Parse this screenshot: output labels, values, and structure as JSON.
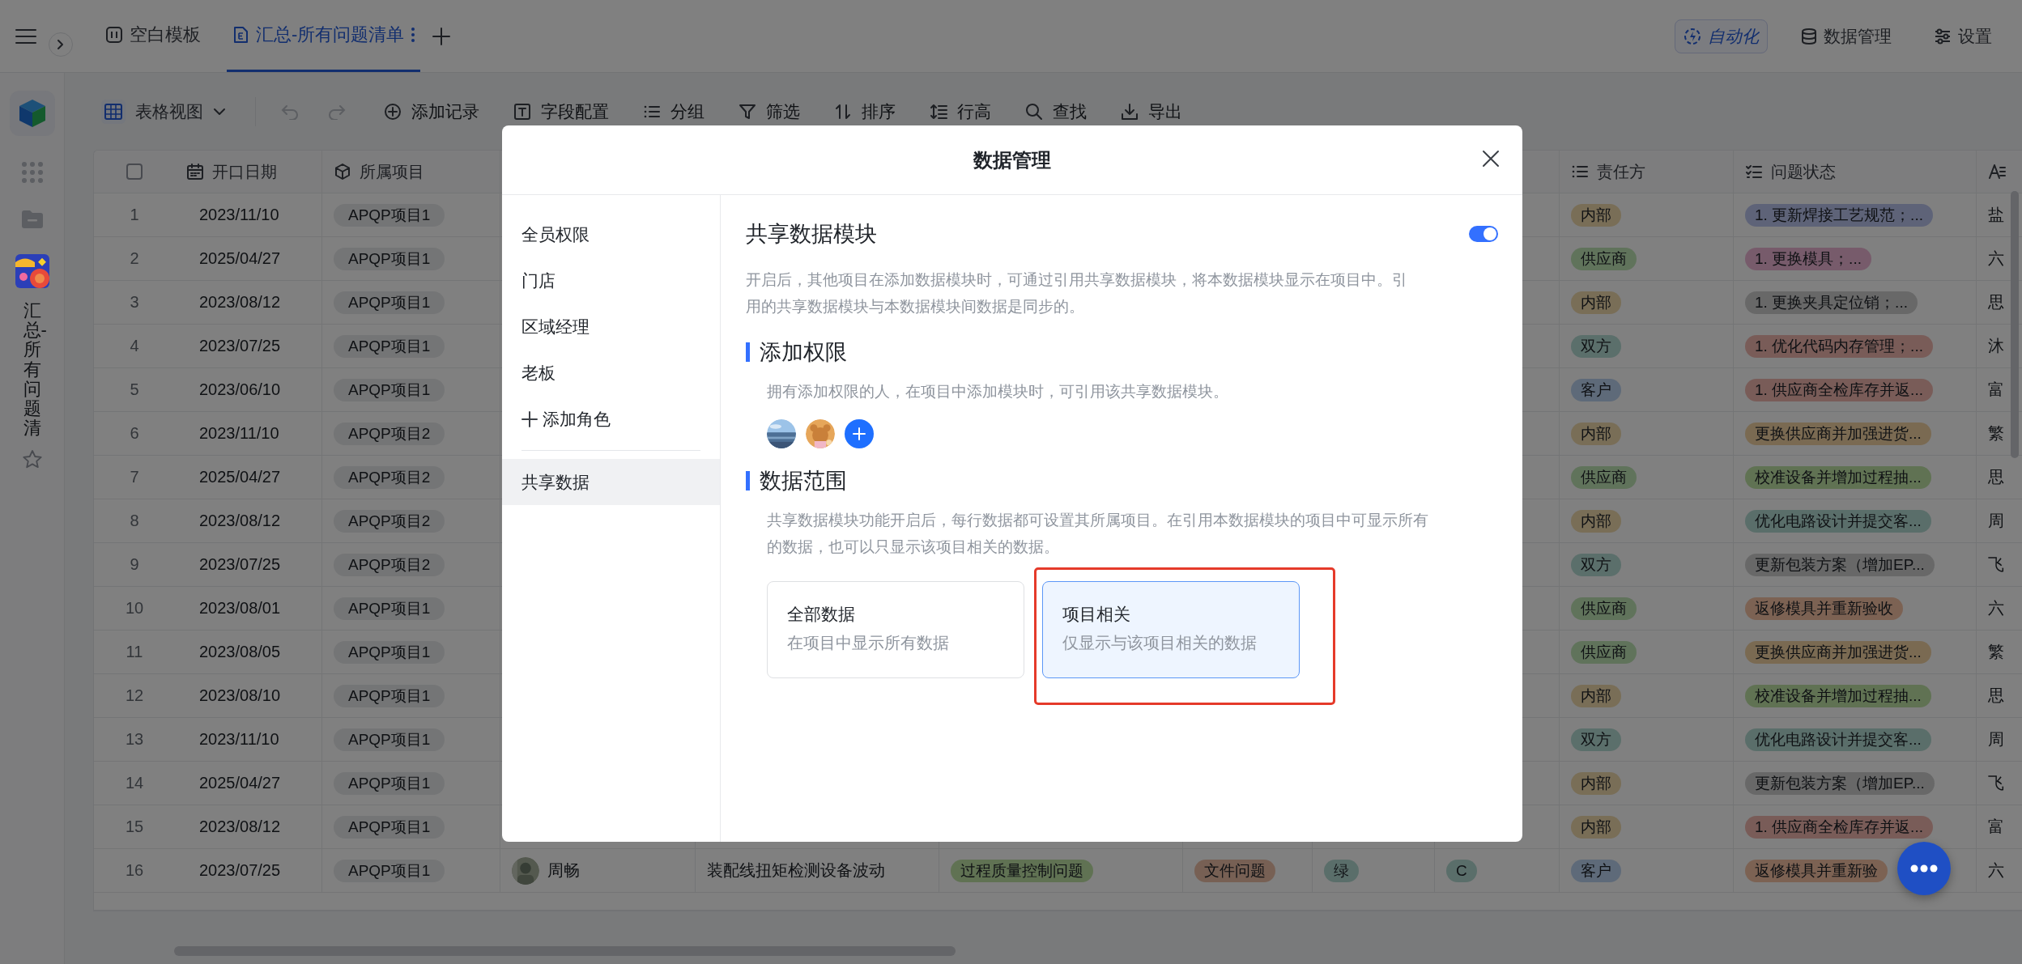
{
  "tabs": [
    {
      "label": "空白模板",
      "selected": false
    },
    {
      "label": "汇总-所有问题清单",
      "selected": true
    }
  ],
  "header_actions": [
    {
      "label": "自动化",
      "highlighted": true
    },
    {
      "label": "数据管理",
      "highlighted": false
    },
    {
      "label": "设置",
      "highlighted": false
    }
  ],
  "rail": {
    "module_title": "汇总-所有问题清"
  },
  "toolbar": {
    "view": "表格视图",
    "actions": [
      "添加记录",
      "字段配置",
      "分组",
      "筛选",
      "排序",
      "行高",
      "查找",
      "导出"
    ]
  },
  "table": {
    "select_all": {
      "checked": false
    },
    "columns": [
      "开口日期",
      "所属项目",
      "责任方",
      "问题状态"
    ],
    "rows": [
      {
        "number": "1",
        "date": "2023/11/10",
        "project": "APQP项目1",
        "owner": {
          "text": "内部",
          "color": "#796e57"
        },
        "status": {
          "text": "1. 更新焊接工艺规范；...",
          "color": "#5e6378"
        },
        "column_12": "盐"
      },
      {
        "number": "2",
        "date": "2025/04/27",
        "project": "APQP项目1",
        "owner": {
          "text": "供应商",
          "color": "#60735b"
        },
        "status": {
          "text": "1. 更换模具；...",
          "color": "#775b6b"
        },
        "column_12": "六"
      },
      {
        "number": "3",
        "date": "2023/08/12",
        "project": "APQP项目1",
        "owner": {
          "text": "内部",
          "color": "#796e57"
        },
        "status": {
          "text": "1. 更换夹具定位销；...",
          "color": "#686868"
        },
        "column_12": "思"
      },
      {
        "number": "4",
        "date": "2023/07/25",
        "project": "APQP项目1",
        "owner": {
          "text": "双方",
          "color": "#5b6f6b"
        },
        "status": {
          "text": "1. 优化代码内存管理；...",
          "color": "#795c58"
        },
        "column_12": "沐"
      },
      {
        "number": "5",
        "date": "2023/06/10",
        "project": "APQP项目1",
        "owner": {
          "text": "客户",
          "color": "#5e6a79"
        },
        "status": {
          "text": "1. 供应商全检库存并返...",
          "color": "#795c58"
        },
        "column_12": "富"
      },
      {
        "number": "6",
        "date": "2023/11/10",
        "project": "APQP项目2",
        "owner": {
          "text": "内部",
          "color": "#796e57"
        },
        "status": {
          "text": "更换供应商并加强进货...",
          "color": "#7a6a52"
        },
        "column_12": "繁"
      },
      {
        "number": "7",
        "date": "2025/04/27",
        "project": "APQP项目2",
        "owner": {
          "text": "供应商",
          "color": "#60735b"
        },
        "status": {
          "text": "校准设备并增加过程抽...",
          "color": "#607253"
        },
        "column_12": "思"
      },
      {
        "number": "8",
        "date": "2023/08/12",
        "project": "APQP项目2",
        "owner": {
          "text": "内部",
          "color": "#796e57"
        },
        "status": {
          "text": "优化电路设计并提交客...",
          "color": "#5a6e6a"
        },
        "column_12": "周"
      },
      {
        "number": "9",
        "date": "2023/07/25",
        "project": "APQP项目2",
        "owner": {
          "text": "双方",
          "color": "#5b6f6b"
        },
        "status": {
          "text": "更新包装方案（增加EP...",
          "color": "#686868"
        },
        "column_12": "飞"
      },
      {
        "number": "10",
        "date": "2023/08/01",
        "project": "APQP项目1",
        "owner": {
          "text": "供应商",
          "color": "#60735b"
        },
        "status": {
          "text": "返修模具并重新验收",
          "color": "#7c6253"
        },
        "column_12": "六"
      },
      {
        "number": "11",
        "date": "2023/08/05",
        "project": "APQP项目1",
        "owner": {
          "text": "供应商",
          "color": "#60735b"
        },
        "status": {
          "text": "更换供应商并加强进货...",
          "color": "#7a6a52"
        },
        "column_12": "繁"
      },
      {
        "number": "12",
        "date": "2023/08/10",
        "project": "APQP项目1",
        "owner": {
          "text": "内部",
          "color": "#796e57"
        },
        "status": {
          "text": "校准设备并增加过程抽...",
          "color": "#607253"
        },
        "column_12": "思"
      },
      {
        "number": "13",
        "date": "2023/11/10",
        "project": "APQP项目1",
        "owner": {
          "text": "双方",
          "color": "#5b6f6b"
        },
        "status": {
          "text": "优化电路设计并提交客...",
          "color": "#5a6e6a"
        },
        "column_12": "周"
      },
      {
        "number": "14",
        "date": "2025/04/27",
        "project": "APQP项目1",
        "owner": {
          "text": "内部",
          "color": "#796e57"
        },
        "status": {
          "text": "更新包装方案（增加EP...",
          "color": "#686868"
        },
        "column_12": "飞"
      },
      {
        "number": "15",
        "date": "2023/08/12",
        "project": "APQP项目1",
        "owner": {
          "text": "内部",
          "color": "#796e57"
        },
        "status": {
          "text": "1. 供应商全检库存并返...",
          "color": "#795c58"
        },
        "column_12": "富"
      },
      {
        "number": "16",
        "date": "2023/07/25",
        "project": "APQP项目1",
        "column_4": {
          "text": "周畅",
          "kind": "picture"
        },
        "column_5": "装配线扭矩检测设备波动",
        "column_6": {
          "text": "过程质量控制问题",
          "color": "#607253"
        },
        "column_7": {
          "text": "文件问题",
          "color": "#776054"
        },
        "column_8": {
          "text": "绿",
          "color": "#5a6e6a"
        },
        "column_9": {
          "text": "C",
          "color": "#5a6e6a"
        },
        "owner": {
          "text": "客户",
          "color": "#5e6a79"
        },
        "status": {
          "text": "返修模具并重新验",
          "color": "#7c6253"
        },
        "column_12": "六"
      }
    ]
  },
  "dialog": {
    "title": "数据管理",
    "menu": {
      "roles": [
        {
          "label": "全员权限",
          "selected": false
        },
        {
          "label": "门店",
          "selected": false
        },
        {
          "label": "区域经理",
          "selected": false
        },
        {
          "label": "老板",
          "selected": false
        }
      ],
      "add_label": "添加角色",
      "shared": [
        {
          "label": "共享数据",
          "selected": true
        }
      ]
    },
    "content": {
      "title": "共享数据模块",
      "toggle_on": true,
      "description": "开启后，其他项目在添加数据模块时，可通过引用共享数据模块，将本数据模块显示在项目中。引用的共享数据模块与本数据模块间数据是同步的。",
      "permission": {
        "title": "添加权限",
        "description": "拥有添加权限的人，在项目中添加模块时，可引用该共享数据模块。"
      },
      "scope": {
        "title": "数据范围",
        "description": "共享数据模块功能开启后，每行数据都可设置其所属项目。在引用本数据模块的项目中可显示所有的数据，也可以只显示该项目相关的数据。",
        "options": [
          {
            "title": "全部数据",
            "subtitle": "在项目中显示所有数据",
            "selected": false,
            "highlighted": false
          },
          {
            "title": "项目相关",
            "subtitle": "仅显示与该项目相关的数据",
            "selected": true,
            "highlighted": true
          }
        ]
      }
    }
  }
}
